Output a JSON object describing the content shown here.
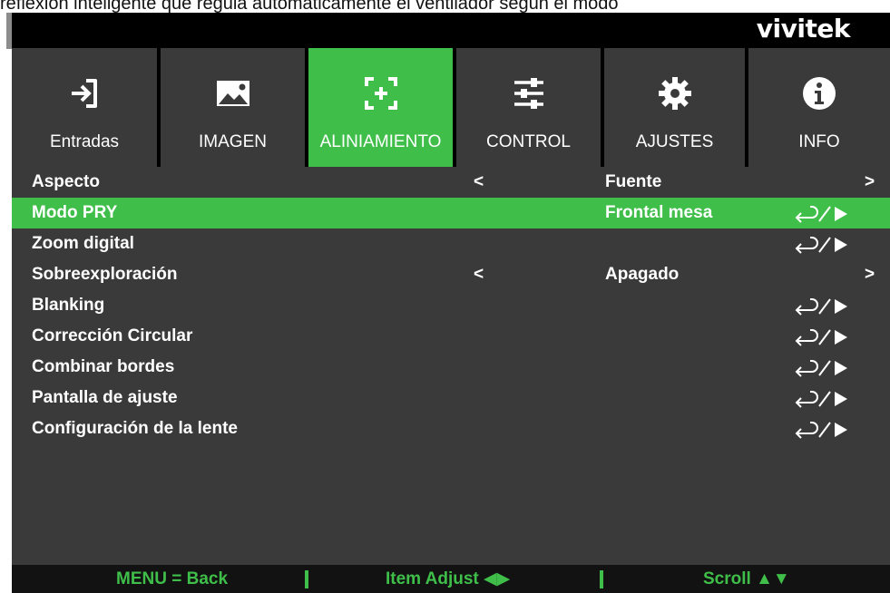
{
  "caption": "reflexión inteligente que regula automáticamente el ventilador según el modo",
  "brand": {
    "logo_text": "vivitek"
  },
  "tabs": [
    {
      "label": "Entradas",
      "icon": "input-arrow-icon",
      "active": false
    },
    {
      "label": "IMAGEN",
      "icon": "picture-icon",
      "active": false
    },
    {
      "label": "ALINIAMIENTO",
      "icon": "alignment-icon",
      "active": true
    },
    {
      "label": "CONTROL",
      "icon": "sliders-icon",
      "active": false
    },
    {
      "label": "AJUSTES",
      "icon": "gear-icon",
      "active": false
    },
    {
      "label": "INFO",
      "icon": "info-icon",
      "active": false
    }
  ],
  "menu": {
    "rows": [
      {
        "label": "Aspecto",
        "value": "Fuente",
        "left_arrow": "<",
        "right_arrow": ">",
        "enter": false,
        "selected": false
      },
      {
        "label": "Modo PRY",
        "value": "Frontal mesa",
        "enter": true,
        "selected": true
      },
      {
        "label": "Zoom digital",
        "value": "",
        "enter": true,
        "selected": false
      },
      {
        "label": "Sobreexploración",
        "value": "Apagado",
        "left_arrow": "<",
        "right_arrow": ">",
        "enter": false,
        "selected": false
      },
      {
        "label": "Blanking",
        "value": "",
        "enter": true,
        "selected": false
      },
      {
        "label": "Corrección Circular",
        "value": "",
        "enter": true,
        "selected": false
      },
      {
        "label": "Combinar bordes",
        "value": "",
        "enter": true,
        "selected": false
      },
      {
        "label": "Pantalla de ajuste",
        "value": "",
        "enter": true,
        "selected": false
      },
      {
        "label": "Configuración de la lente",
        "value": "",
        "enter": true,
        "selected": false
      }
    ]
  },
  "footer": {
    "back": "MENU = Back",
    "adjust": "Item Adjust ◀▶",
    "scroll": "Scroll ▲▼"
  },
  "colors": {
    "accent": "#3fbf4a",
    "panel": "#3a3a3a",
    "bar": "#000000"
  }
}
